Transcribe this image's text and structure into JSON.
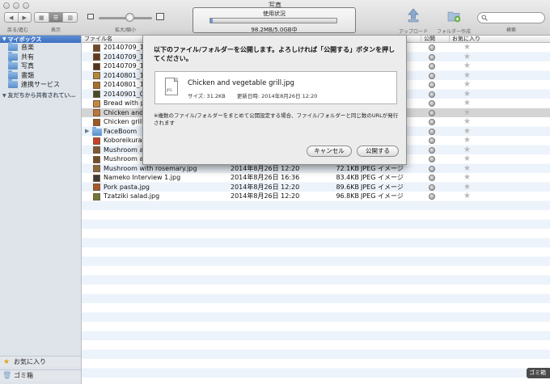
{
  "window": {
    "title": "写真"
  },
  "toolbar": {
    "nav_label": "戻る/進む",
    "view_label": "表示",
    "zoom_label": "拡大/縮小",
    "upload_label": "アップロード",
    "new_folder_label": "フォルダー作成",
    "search_label": "検索",
    "zoom_level": 0.58
  },
  "usage": {
    "title": "使用状況",
    "text": "98.2MB/5.0GB中",
    "fraction": 0.02
  },
  "sidebar": {
    "section_my_box": "マイボックス",
    "items": [
      {
        "label": "音楽"
      },
      {
        "label": "共有"
      },
      {
        "label": "写真"
      },
      {
        "label": "書類"
      },
      {
        "label": "連携サービス"
      }
    ],
    "section_shared": "友だちから共有されてい…",
    "favorites": "お気に入り",
    "trash": "ゴミ箱"
  },
  "list": {
    "columns": {
      "name": "ファイル名",
      "public": "公開",
      "favorite": "お気に入り"
    },
    "rows": [
      {
        "name": "20140709_1",
        "date": "",
        "size": "",
        "kind": "",
        "thumb": "#6b4a2f",
        "public": true
      },
      {
        "name": "20140709_1",
        "date": "",
        "size": "",
        "kind": "",
        "thumb": "#5d3b22",
        "public": true
      },
      {
        "name": "20140709_1",
        "date": "",
        "size": "",
        "kind": "",
        "thumb": "#4f3622",
        "public": true
      },
      {
        "name": "20140801_1",
        "date": "",
        "size": "",
        "kind": "",
        "thumb": "#b08a3a",
        "public": true
      },
      {
        "name": "20140801_1",
        "date": "",
        "size": "",
        "kind": "",
        "thumb": "#a3702e",
        "public": true
      },
      {
        "name": "20140901_0",
        "date": "",
        "size": "",
        "kind": "",
        "thumb": "#3f4f2a",
        "public": true
      },
      {
        "name": "Bread with p",
        "date": "",
        "size": "",
        "kind": "",
        "thumb": "#c08a42",
        "public": true
      },
      {
        "name": "Chicken and",
        "date": "",
        "size": "",
        "kind": "",
        "thumb": "#b9773a",
        "public": true,
        "selected": true
      },
      {
        "name": "Chicken grill",
        "date": "",
        "size": "",
        "kind": "",
        "thumb": "#9a5a2a",
        "public": true
      },
      {
        "name": "FaceBoom",
        "date": "",
        "size": "",
        "kind": "",
        "folder": true,
        "public": true
      },
      {
        "name": "Koboreikura",
        "date": "",
        "size": "",
        "kind": "",
        "thumb": "#c8412a",
        "public": true
      },
      {
        "name": "Mushroom a",
        "date": "",
        "size": "",
        "kind": "",
        "thumb": "#7d5a33",
        "public": true
      },
      {
        "name": "Mushroom a",
        "date": "",
        "size": "",
        "kind": "",
        "thumb": "#6d4f2d",
        "public": true
      },
      {
        "name": "Mushroom with rosemary.jpg",
        "date": "2014年8月26日 12:20",
        "size": "72.1KB",
        "kind": "JPEG イメージ",
        "thumb": "#8a6a3b",
        "public": true
      },
      {
        "name": "Nameko Interview 1.jpg",
        "date": "2014年8月26日 16:36",
        "size": "83.4KB",
        "kind": "JPEG イメージ",
        "thumb": "#3b3b3b",
        "public": true
      },
      {
        "name": "Pork pasta.jpg",
        "date": "2014年8月26日 12:20",
        "size": "89.6KB",
        "kind": "JPEG イメージ",
        "thumb": "#a45a2a",
        "public": true
      },
      {
        "name": "Tzatziki salad.jpg",
        "date": "2014年8月26日 12:20",
        "size": "96.8KB",
        "kind": "JPEG イメージ",
        "thumb": "#6a7a3a",
        "public": true
      }
    ]
  },
  "dialog": {
    "message": "以下のファイル/フォルダーを公開します。よろしければ「公開する」ボタンを押してください。",
    "file_name": "Chicken and vegetable grill.jpg",
    "file_size": "サイズ: 31.2KB",
    "file_date": "更新日時: 2014年8月26日 12:20",
    "note": "※複数のファイル/フォルダーをまとめて公開設定する場合、ファイル/フォルダーと同じ数のURLが発行されます",
    "cancel_label": "キャンセル",
    "publish_label": "公開する",
    "file_icon_tag": "JPG"
  },
  "corner_badge": "ゴミ箱"
}
